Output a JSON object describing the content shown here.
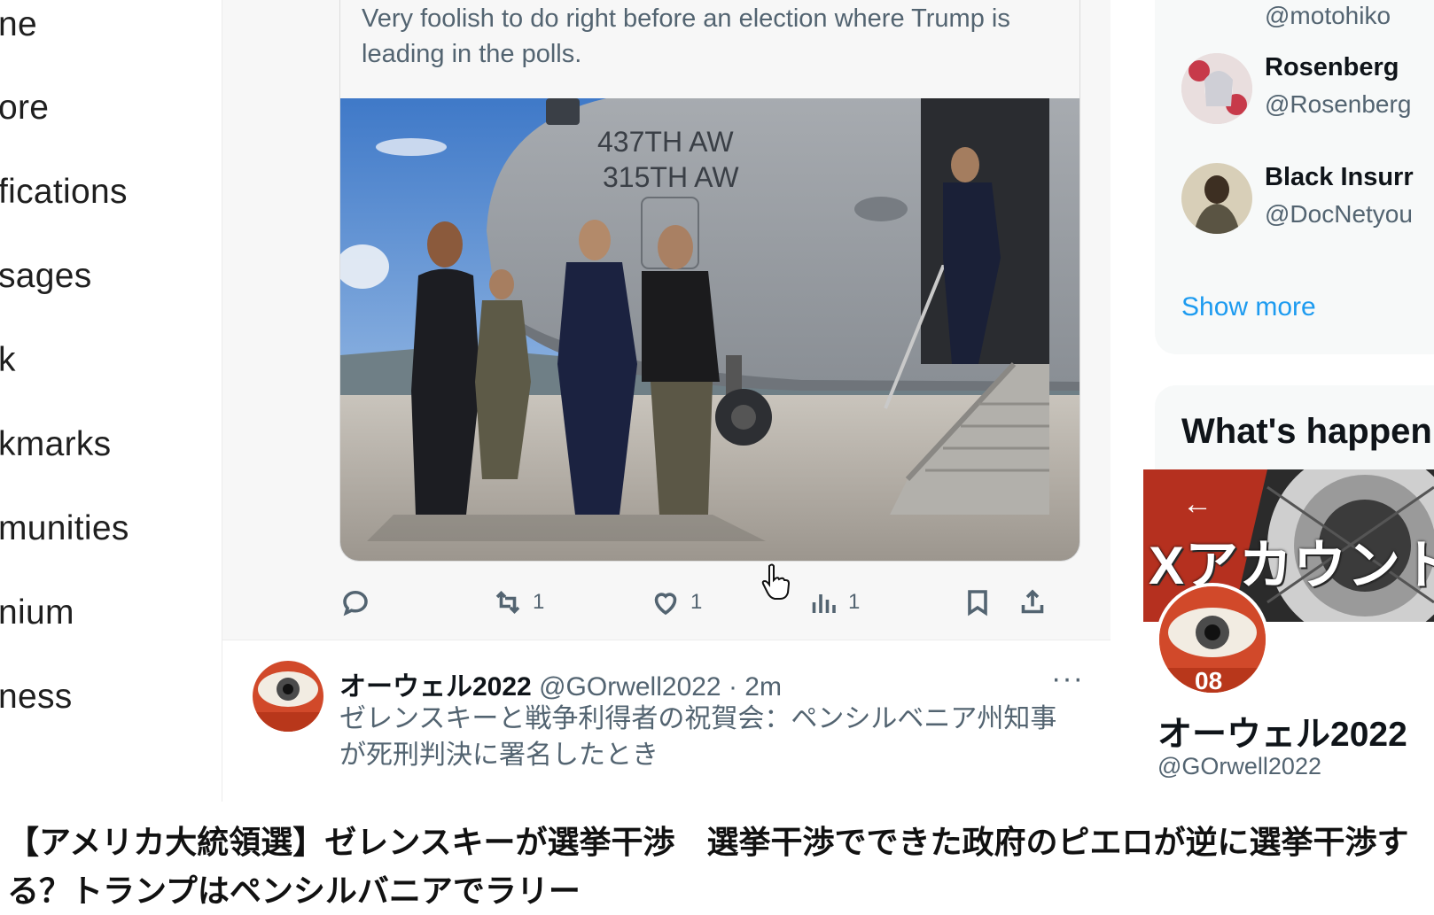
{
  "left_nav": {
    "items": [
      "ne",
      "ore",
      "fications",
      "sages",
      "k",
      "kmarks",
      "munities",
      "nium",
      "ness"
    ]
  },
  "quoted_post": {
    "text": "Very foolish to do right before an election where Trump is leading in the polls.",
    "photo_markings": [
      "437TH AW",
      "315TH AW"
    ]
  },
  "actions": {
    "reply": "",
    "repost": "1",
    "like": "1",
    "views": "1"
  },
  "post": {
    "display_name": "オーウェル2022",
    "meta": " @GOrwell2022 · 2m",
    "more": "···",
    "text": "ゼレンスキーと戦争利得者の祝賀会：ペンシルベニア州知事が死刑判決に署名したとき"
  },
  "who_to_follow": {
    "top_handle": "@motohiko",
    "accounts": [
      {
        "name": "Rosenberg",
        "handle": "@Rosenberg"
      },
      {
        "name": "Black Insurr",
        "handle": "@DocNetyou"
      }
    ],
    "show_more": "Show more"
  },
  "trends": {
    "title": "What's happen"
  },
  "profile_popup": {
    "banner_text": "Xアカウント",
    "back": "←",
    "avatar_badge": "08",
    "name": "オーウェル2022",
    "handle": "@GOrwell2022"
  },
  "caption": "【アメリカ大統領選】ゼレンスキーが選挙干渉　選挙干渉でできた政府のピエロが逆に選挙干渉する？トランプはペンシルバニアでラリー",
  "colors": {
    "accent": "#1d9bf0",
    "secondary_text": "#536471",
    "primary_text": "#0f1419"
  }
}
